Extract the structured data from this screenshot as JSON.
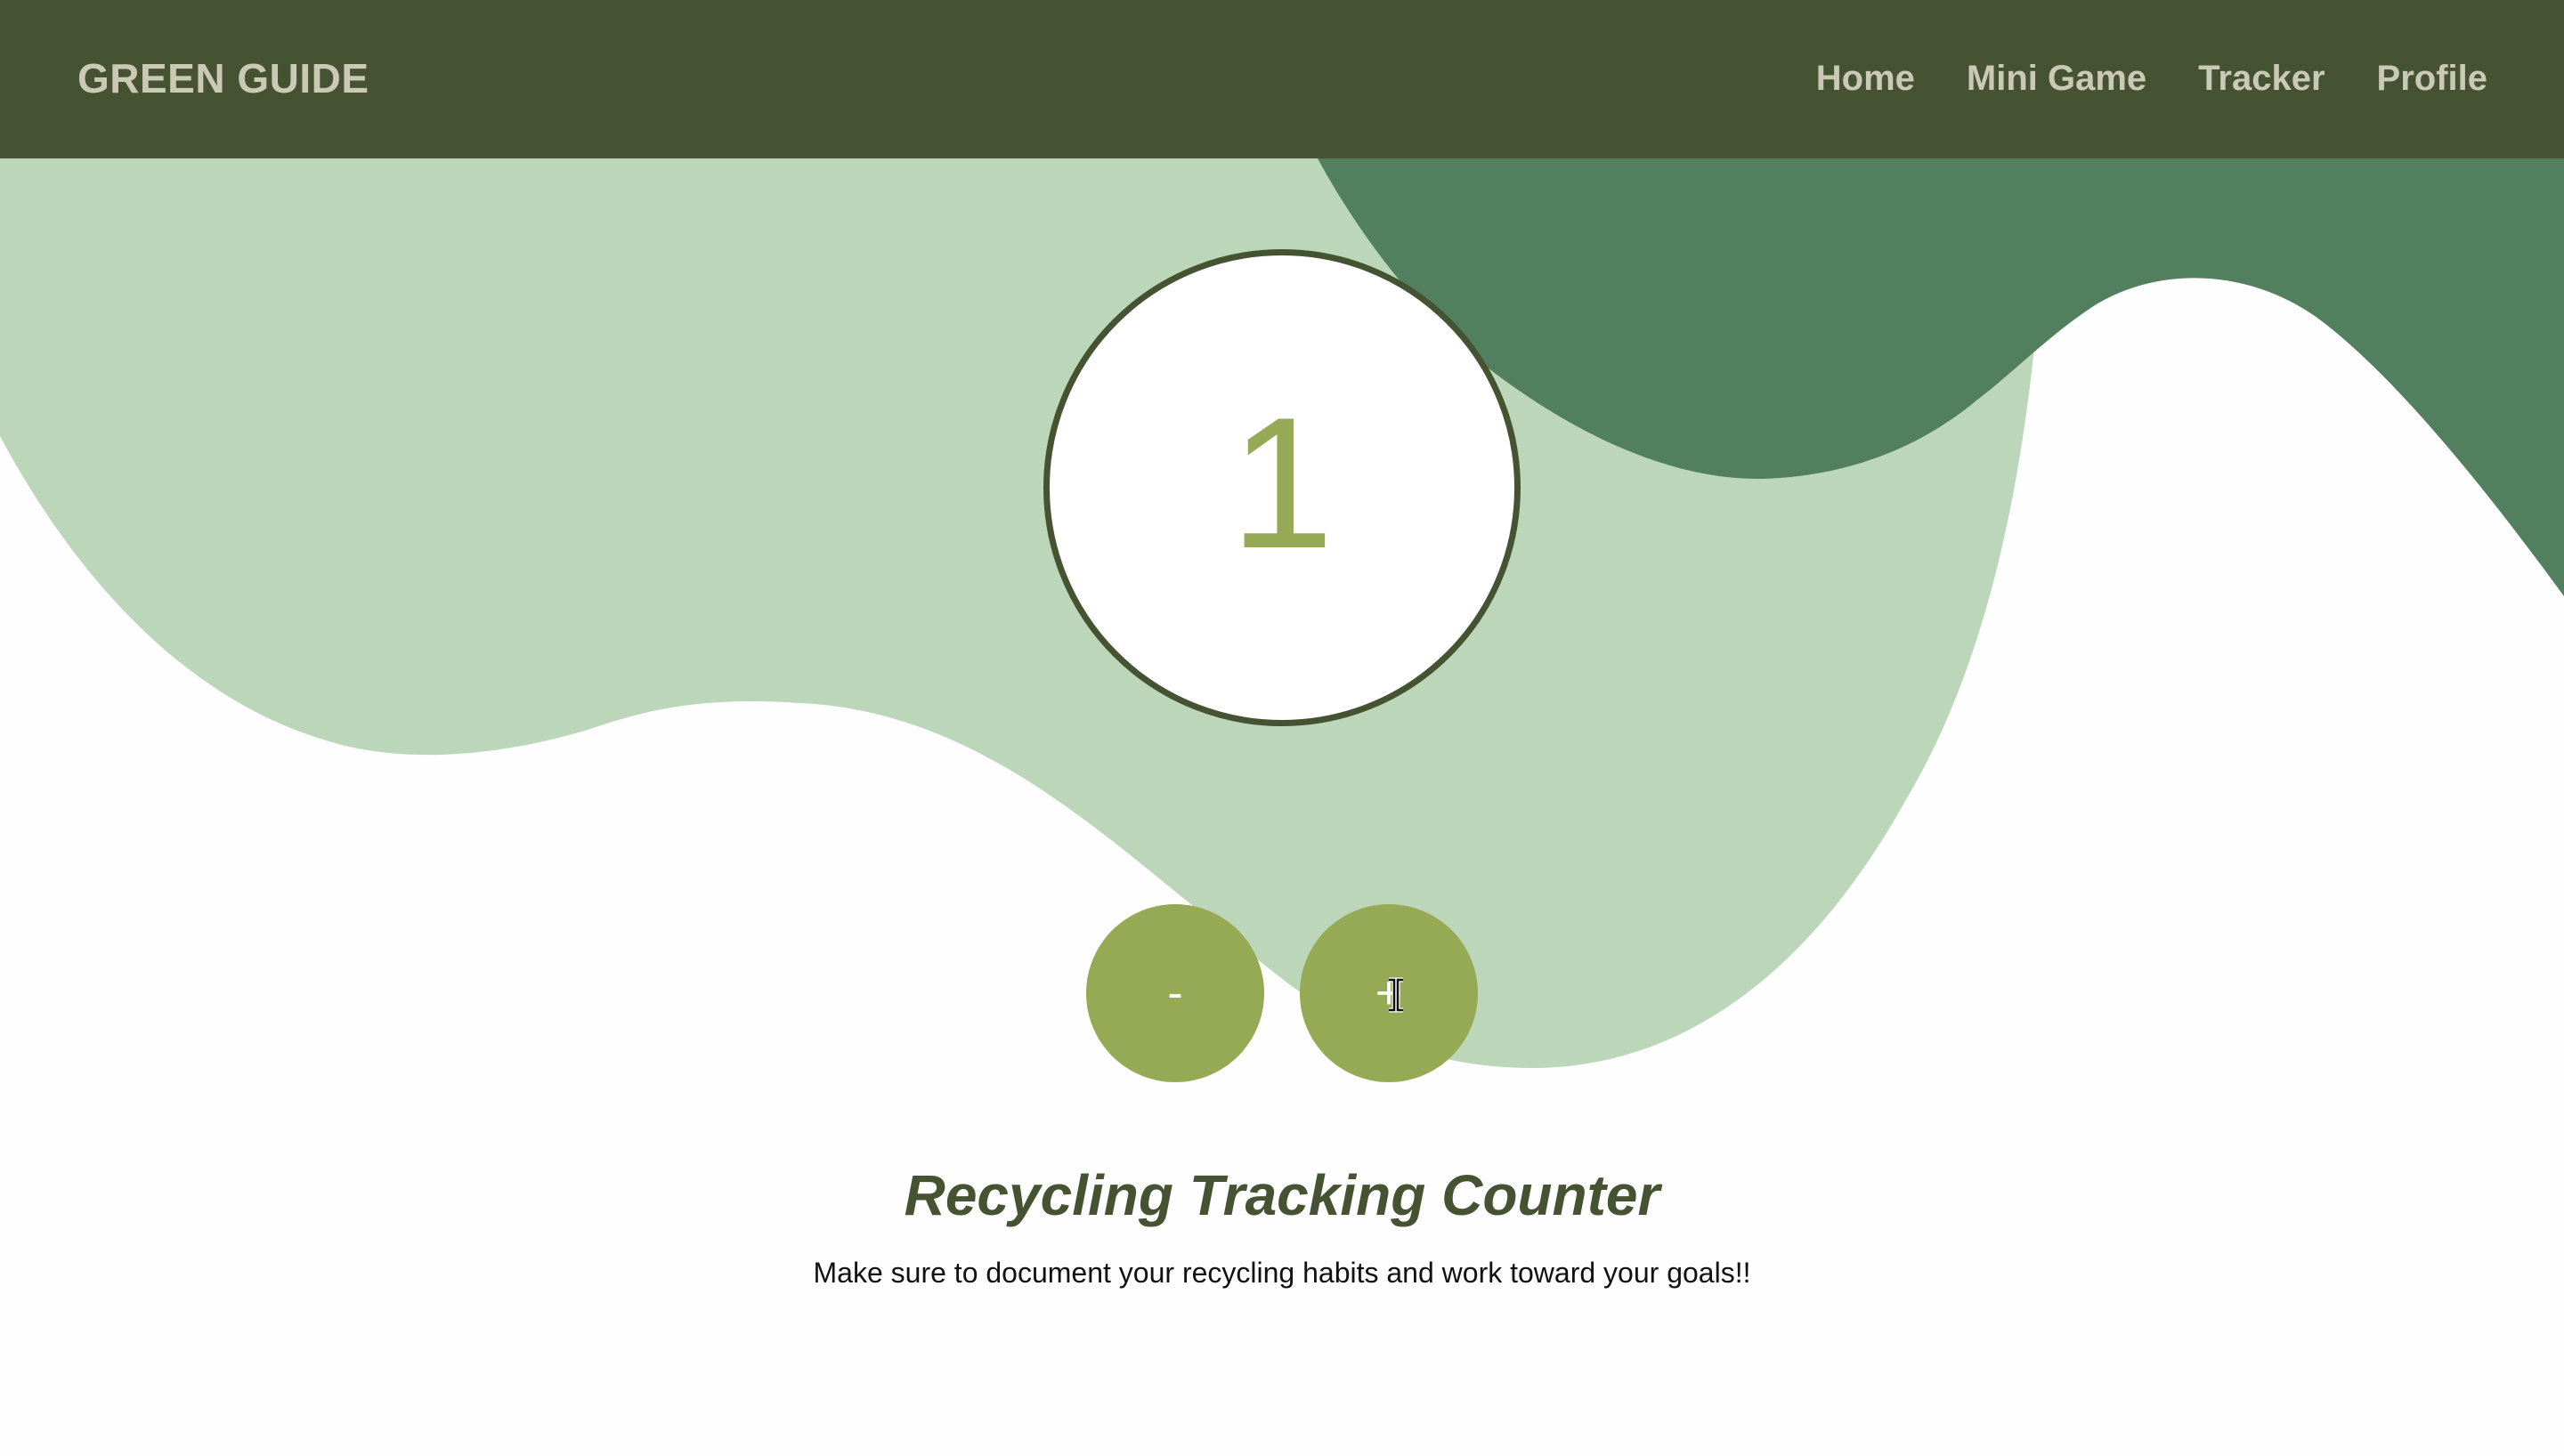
{
  "navbar": {
    "brand": "GREEN GUIDE",
    "links": [
      "Home",
      "Mini Game",
      "Tracker",
      "Profile"
    ]
  },
  "counter": {
    "value": "1"
  },
  "controls": {
    "decrement_label": "-",
    "increment_label": "+"
  },
  "content": {
    "title": "Recycling Tracking Counter",
    "subtitle": "Make sure to document your recycling habits and work toward your goals!!"
  },
  "colors": {
    "nav_bg": "#455332",
    "nav_text": "#c9c9b5",
    "light_blob": "#bbd6b8",
    "dark_blob": "#52805e",
    "accent": "#96a954",
    "heading": "#455332"
  }
}
